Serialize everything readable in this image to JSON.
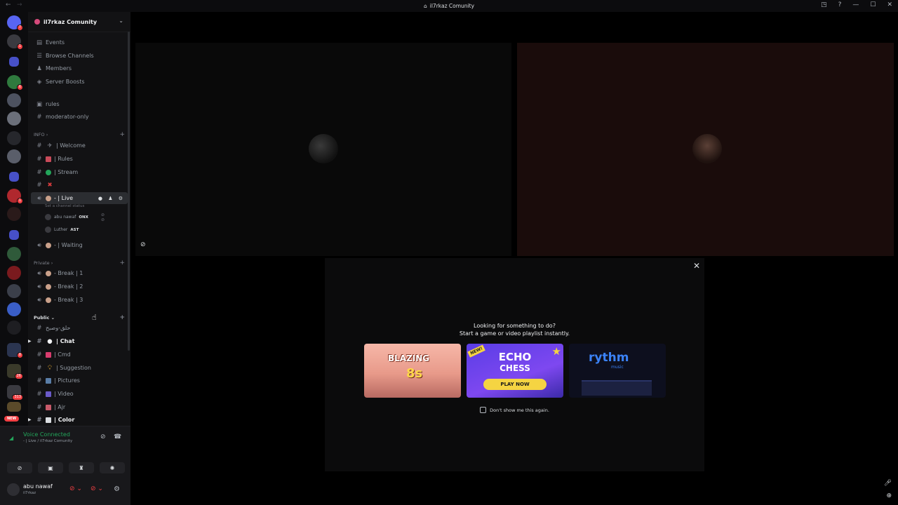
{
  "window": {
    "title": "il7rkaz Comunity",
    "buttons": [
      "◳",
      "?",
      "—",
      "☐",
      "✕"
    ]
  },
  "server": {
    "name": "il7rkaz Comunity"
  },
  "nav": {
    "events": "Events",
    "browse": "Browse Channels",
    "members": "Members",
    "boosts": "Server Boosts"
  },
  "channels": {
    "rules": "rules",
    "moderator": "moderator-only",
    "cat_info": "INFO",
    "welcome": "| Welcome",
    "rules2": "| Rules",
    "stream": "| Stream",
    "live": "- | Live",
    "live_status": "Set a channel status",
    "voice_users": [
      {
        "name": "abu nawaf",
        "tag": "ONX"
      },
      {
        "name": "Luther",
        "tag": "AST"
      }
    ],
    "waiting": "- | Waiting",
    "cat_private": "Private",
    "break1": "- Break | 1",
    "break2": "- Break | 2",
    "break3": "- Break | 3",
    "cat_public": "Public",
    "arabic": "حلق-وصبح",
    "chat": "| Chat",
    "cmd": "| Cmd",
    "suggestion": "| Suggestion",
    "pictures": "| Pictures",
    "video": "| Video",
    "ajr": "| Ajr",
    "color": "| Color"
  },
  "rail": {
    "badges": [
      "7",
      "1",
      "6",
      "1",
      "8",
      "26",
      "313"
    ],
    "new_label": "NEW"
  },
  "voice": {
    "status": "Voice Connected",
    "location": "- | Live / il7rkaz Comunity"
  },
  "user": {
    "name": "abu nawaf",
    "sub": "il7rkaz"
  },
  "activity": {
    "line1": "Looking for something to do?",
    "line2": "Start a game or video playlist instantly.",
    "card1_title": "BLAZING",
    "card1_sub": "8s",
    "card2_new": "NEW!",
    "card2_title": "ECHO",
    "card2_sub": "CHESS",
    "card2_button": "PLAY NOW",
    "card3_title": "rythm",
    "card3_sub": "music",
    "checkbox": "Don't show me this again."
  }
}
